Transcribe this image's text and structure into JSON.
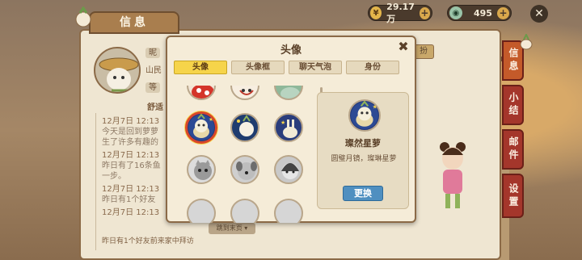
{
  "top_bar": {
    "currency1": {
      "value": "29.17万",
      "icon": "coin-icon"
    },
    "currency2": {
      "value": "495",
      "icon": "gem-icon"
    }
  },
  "info_panel": {
    "tab_title": "信息",
    "nickname_label": "昵",
    "region_text": "山民",
    "level_label": "等",
    "comfort_text": "舒适",
    "sign_text": "扮",
    "jump_btn": "跳到末页 ▾",
    "logs": [
      {
        "date": "12月7日 12:13",
        "text": "今天是回到萝萝"
      },
      {
        "date": "",
        "text": "生了许多有趣的"
      },
      {
        "date": "12月7日 12:13",
        "text": ""
      },
      {
        "date": "",
        "text": "昨日有了16条鱼"
      },
      {
        "date": "",
        "text": "一步。"
      },
      {
        "date": "12月7日 12:13",
        "text": "昨日有1个好友"
      },
      {
        "date": "12月7日 12:13",
        "text": ""
      },
      {
        "date": "",
        "text": "昨日有1个好友前来家中拜访"
      }
    ]
  },
  "side_tabs": [
    "信息",
    "小结",
    "邮件",
    "设置"
  ],
  "modal": {
    "title": "头像",
    "tabs": [
      "头像",
      "头像框",
      "聊天气泡",
      "身份"
    ],
    "active_tab": 0,
    "selected_name": "璨然星萝",
    "selected_desc": "圆璧月镜，璨琳星萝",
    "change_button": "更换"
  },
  "colors": {
    "accent_yellow": "#f6d44a",
    "button_blue": "#4f8fc0",
    "side_tab_red": "#a4362b",
    "selected_ring": "#d9462a"
  }
}
